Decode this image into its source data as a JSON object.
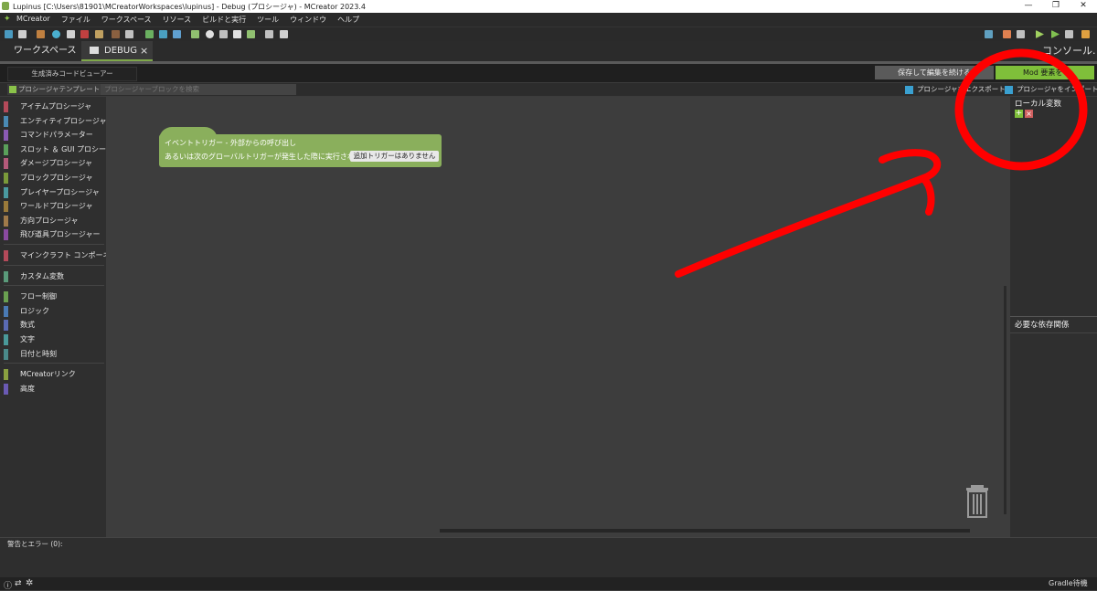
{
  "window": {
    "title": "Lupinus [C:\\Users\\81901\\MCreatorWorkspaces\\lupinus] - Debug (プロシージャ) - MCreator 2023.4",
    "minimize": "—",
    "maximize": "❐",
    "close": "✕"
  },
  "menu": {
    "items": [
      "MCreator",
      "ファイル",
      "ワークスペース",
      "リソース",
      "ビルドと実行",
      "ツール",
      "ウィンドウ",
      "ヘルプ"
    ]
  },
  "toolbar": {
    "left_icons": [
      "workspace-icon",
      "texture-icon",
      "sound-icon",
      "block-icon",
      "item-icon",
      "armor-icon",
      "recipe-icon",
      "loot-icon",
      "gui-icon",
      "biome-icon",
      "dimension-icon",
      "structure-icon",
      "entity-icon",
      "particle-icon",
      "plant-icon",
      "tool-icon",
      "food-icon",
      "overlay-icon",
      "procedure-icon"
    ],
    "right_icons": [
      "map-icon",
      "brush-icon",
      "hammer-icon",
      "export-icon",
      "run-icon",
      "debug-run-icon",
      "stop-icon",
      "build-icon"
    ]
  },
  "tabs": [
    {
      "label": "ワークスペース"
    },
    {
      "label": "DEBUG",
      "close": "×"
    }
  ],
  "console_label": "コンソール.",
  "codebar": {
    "viewer_label": "生成済みコードビューアー",
    "save_label": "保存して編集を続ける",
    "mod_label": "Mod 要素を"
  },
  "searchrow": {
    "template_label": "プロシージャテンプレート",
    "search_placeholder": "プロシージャーブロックを検索",
    "export_label": "プロシージャをエクスポート",
    "import_label": "プロシージャをインポート"
  },
  "palette": {
    "groups": [
      [
        {
          "label": "アイテムプロシージャ",
          "color": "#b44a5a"
        },
        {
          "label": "エンティティプロシージャ",
          "color": "#4a8ab4"
        },
        {
          "label": "コマンドパラメーター",
          "color": "#8a5ab4"
        },
        {
          "label": "スロット ＆ GUI プロシージャ",
          "color": "#5aa05a"
        },
        {
          "label": "ダメージプロシージャ",
          "color": "#b45a7a"
        },
        {
          "label": "ブロックプロシージャ",
          "color": "#7a9a3a"
        },
        {
          "label": "プレイヤープロシージャ",
          "color": "#4a9aa0"
        },
        {
          "label": "ワールドプロシージャ",
          "color": "#9a7a3a"
        },
        {
          "label": "方向プロシージャ",
          "color": "#a07a4a"
        },
        {
          "label": "飛び道具プロシージャー",
          "color": "#8a4aa0"
        }
      ],
      [
        {
          "label": "マインクラフト コンポーネント",
          "color": "#b44a5a"
        }
      ],
      [
        {
          "label": "カスタム変数",
          "color": "#5a9a7a"
        }
      ],
      [
        {
          "label": "フロー制御",
          "color": "#6aa050"
        },
        {
          "label": "ロジック",
          "color": "#4a7ab4"
        },
        {
          "label": "数式",
          "color": "#5a6ab4"
        },
        {
          "label": "文字",
          "color": "#4a9a9a"
        },
        {
          "label": "日付と時刻",
          "color": "#4a8a8a"
        }
      ],
      [
        {
          "label": "MCreatorリンク",
          "color": "#8aa040"
        },
        {
          "label": "高度",
          "color": "#6a5ab4"
        }
      ]
    ]
  },
  "event_block": {
    "line1": "イベントトリガー - 外部からの呼び出し",
    "line2": "あるいは次のグローバルトリガーが発生した際に実行される",
    "trigger_value": "追加トリガーはありません",
    "color": "#8aaf5c"
  },
  "right_panel": {
    "local_vars_title": "ローカル変数",
    "add": "+",
    "remove": "×",
    "deps_title": "必要な依存関係"
  },
  "errors": {
    "label": "警告とエラー (0):"
  },
  "status": {
    "gradle": "Gradle待機"
  },
  "annotation": {
    "color": "#ff0000"
  }
}
